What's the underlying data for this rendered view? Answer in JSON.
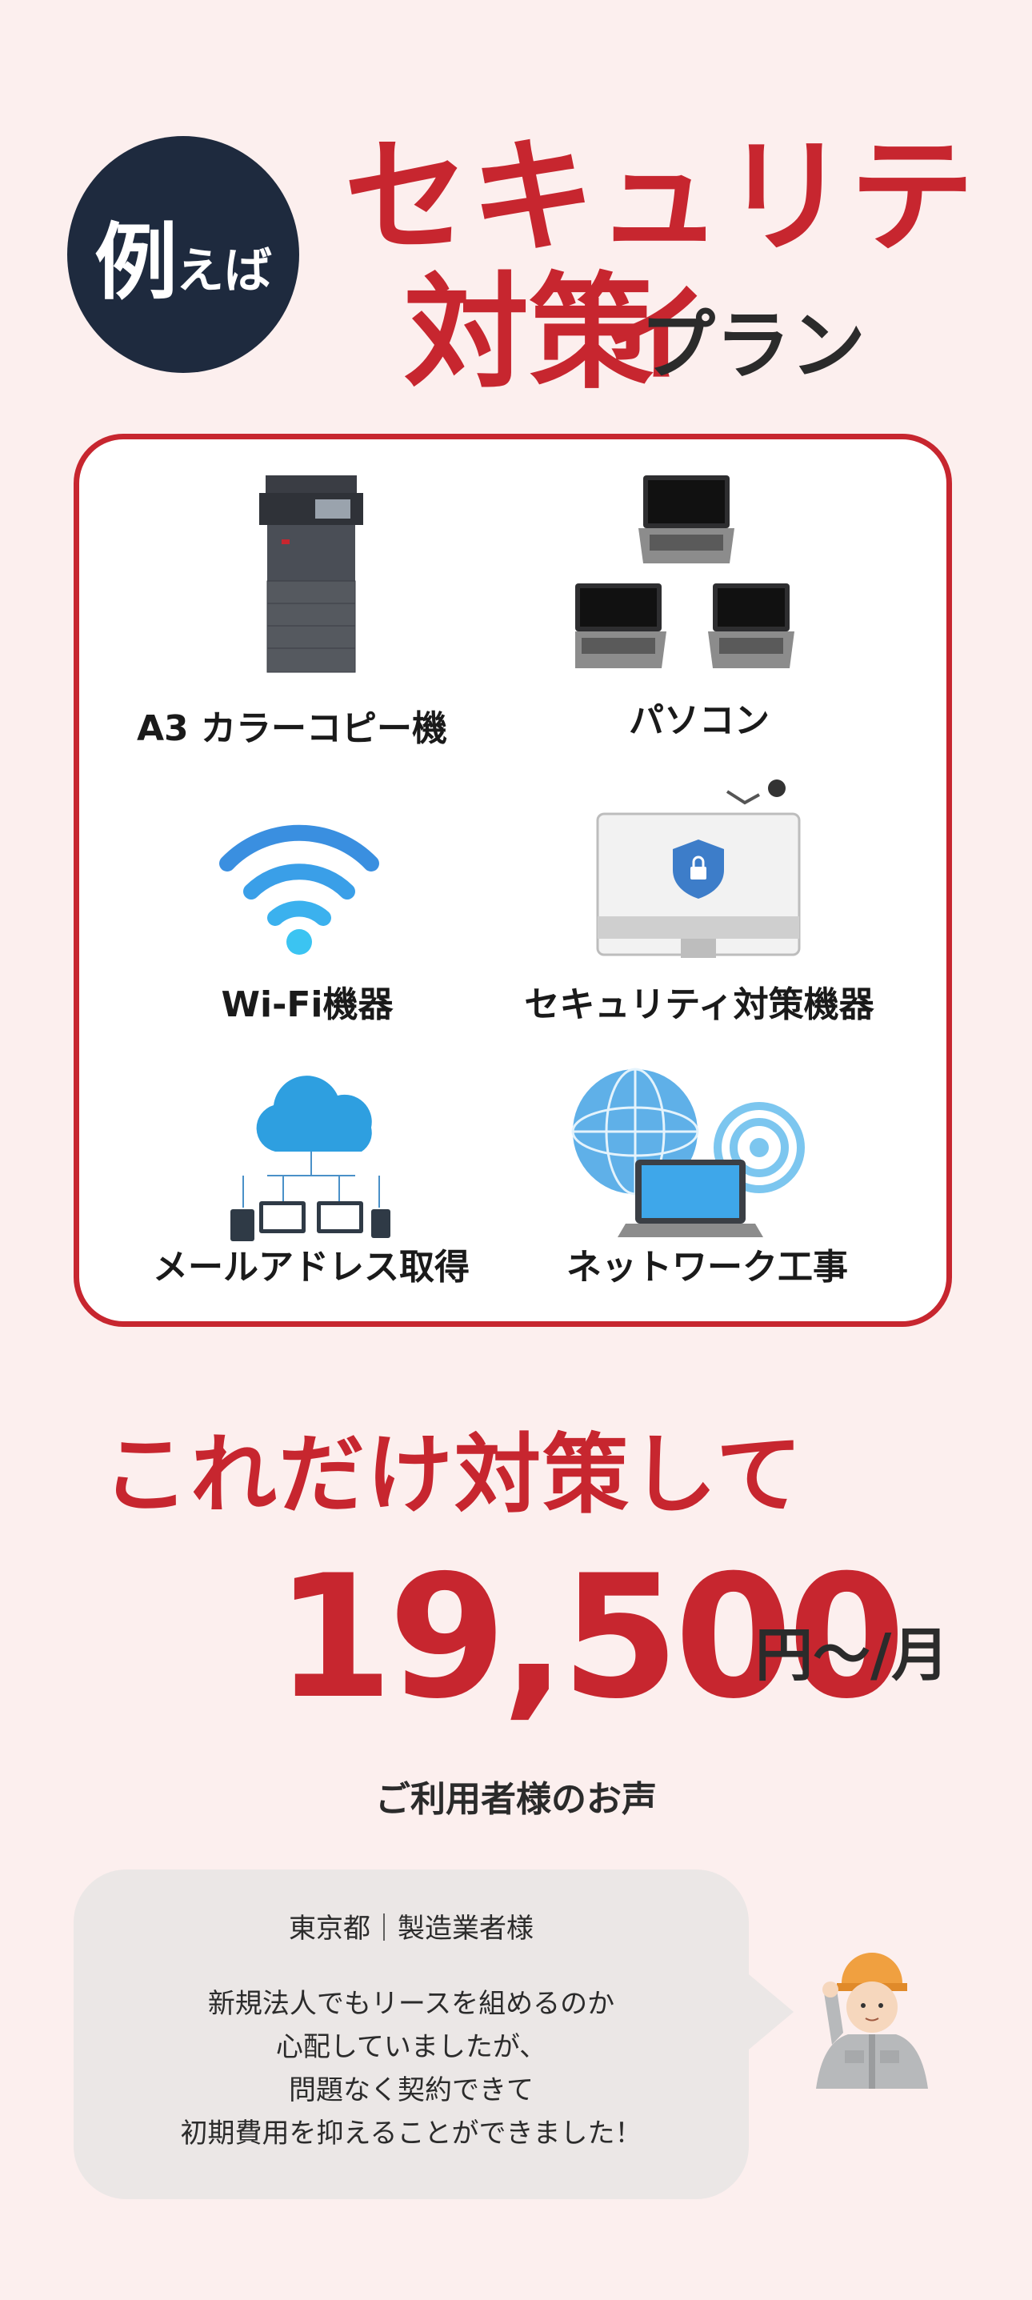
{
  "header": {
    "badge_main": "例",
    "badge_sub": "えば",
    "title_line1": "セキュリティ",
    "title_line2": "対策",
    "title_suffix": "プラン"
  },
  "items": [
    {
      "label": "A3 カラーコピー機",
      "icon": "copier-icon"
    },
    {
      "label": "パソコン",
      "icon": "laptops-icon"
    },
    {
      "label": "Wi-Fi機器",
      "icon": "wifi-icon"
    },
    {
      "label": "セキュリティ対策機器",
      "icon": "security-monitor-icon"
    },
    {
      "label": "メールアドレス取得",
      "icon": "cloud-network-icon"
    },
    {
      "label": "ネットワーク工事",
      "icon": "globe-laptop-icon"
    }
  ],
  "price": {
    "lead": "これだけ対策して",
    "amount": "19,500",
    "unit": "円～/月"
  },
  "voice": {
    "title": "ご利用者様のお声",
    "customer": "東京都｜製造業者様",
    "comment_lines": [
      "新規法人でもリースを組めるのか",
      "心配していましたが、",
      "問題なく契約できて",
      "初期費用を抑えることができました！"
    ]
  },
  "colors": {
    "accent": "#c7262f",
    "background": "#fcefee",
    "badge": "#1e2a3e"
  }
}
